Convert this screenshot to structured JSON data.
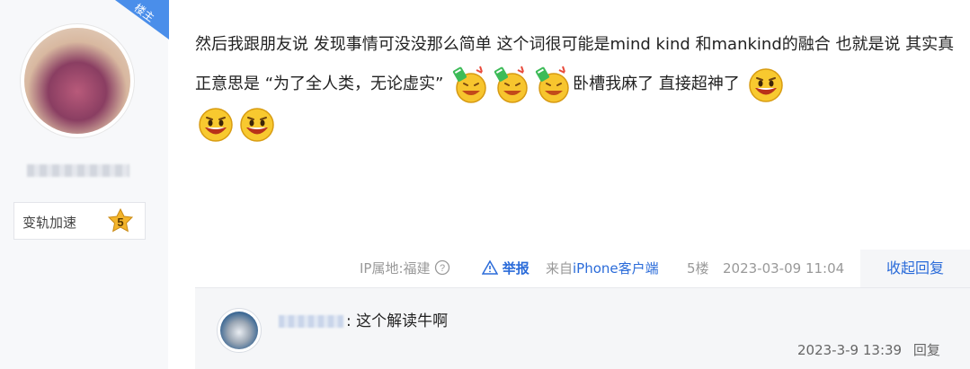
{
  "colors": {
    "accent": "#2a6bd9",
    "ribbon": "#4a8eea",
    "sidebar_bg": "#f7f8fa"
  },
  "author": {
    "ribbon_label": "楼主",
    "badge_label": "变轨加速",
    "level": "5"
  },
  "post": {
    "text_1": "然后我跟朋友说 发现事情可没没那么简单 这个词很可能是mind kind 和mankind的融合 也就是说 其实真正意思是 “为了全人类，无论虚实”",
    "text_2": "卧槽我麻了 直接超神了",
    "emoji_1": "celebration-emoji",
    "emoji_2": "surprised-laughing-emoji"
  },
  "meta": {
    "ip_location": "IP属地:福建",
    "help_icon": "question-circle-icon",
    "report_label": "举报",
    "source_prefix": "来自",
    "source_client": "iPhone客户端",
    "floor": "5楼",
    "datetime": "2023-03-09 11:04",
    "collapse_replies": "收起回复"
  },
  "reply": {
    "text": ": 这个解读牛啊",
    "datetime": "2023-3-9 13:39",
    "reply_label": "回复"
  }
}
